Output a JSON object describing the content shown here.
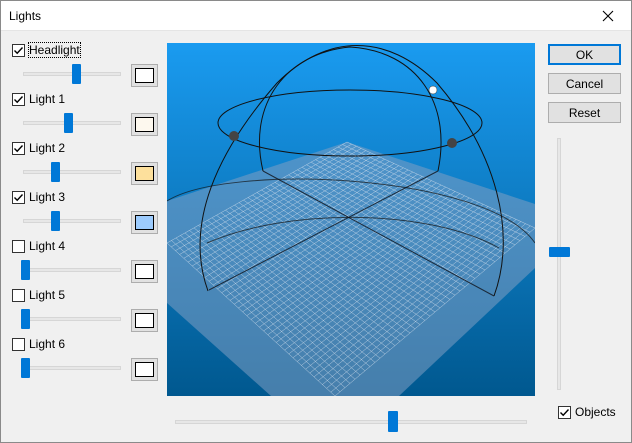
{
  "window": {
    "title": "Lights"
  },
  "lights": [
    {
      "label": "Headlight",
      "checked": true,
      "slider": 0.55,
      "color": "#ffffff"
    },
    {
      "label": "Light 1",
      "checked": true,
      "slider": 0.47,
      "color": "#fdf8ee"
    },
    {
      "label": "Light 2",
      "checked": true,
      "slider": 0.33,
      "color": "#fde09c"
    },
    {
      "label": "Light 3",
      "checked": true,
      "slider": 0.33,
      "color": "#9ccbfd"
    },
    {
      "label": "Light 4",
      "checked": false,
      "slider": 0.0,
      "color": "#ffffff"
    },
    {
      "label": "Light 5",
      "checked": false,
      "slider": 0.0,
      "color": "#ffffff"
    },
    {
      "label": "Light 6",
      "checked": false,
      "slider": 0.0,
      "color": "#ffffff"
    }
  ],
  "buttons": {
    "ok": "OK",
    "cancel": "Cancel",
    "reset": "Reset"
  },
  "objects": {
    "label": "Objects",
    "checked": true
  },
  "elevation_slider": 0.43,
  "azimuth_slider": 0.62,
  "colors": {
    "accent": "#0078d7",
    "viewport_top": "#1a9bf0",
    "viewport_bottom": "#00588f"
  }
}
